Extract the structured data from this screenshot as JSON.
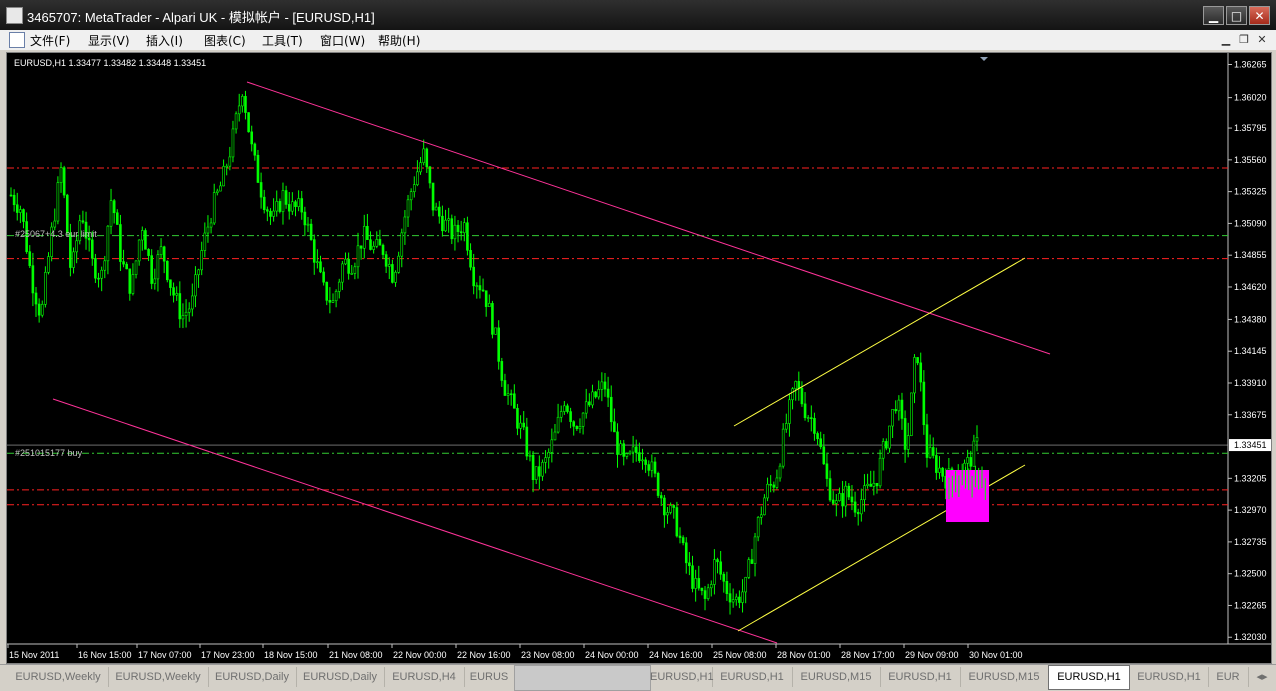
{
  "window": {
    "title": "3465707: MetaTrader - Alpari UK - 模拟帐户 - [EURUSD,H1]",
    "minimize": "▁",
    "maximize": "□",
    "close": "✕"
  },
  "menu": [
    "文件(F)",
    "显示(V)",
    "插入(I)",
    "图表(C)",
    "工具(T)",
    "窗口(W)",
    "帮助(H)"
  ],
  "chart": {
    "header": "EURUSD,H1  1.33477 1.33482 1.33448 1.33451",
    "current_price": "1.33451",
    "order_label_1": "#25067+4.3 eur limit",
    "order_label_2": "#251015177 buy",
    "colors": {
      "background": "#000000",
      "candles": "#00ff00",
      "channel": "#ff3399",
      "triangle": "#ffff44",
      "level_red": "#ff2222",
      "level_green": "#33cc33",
      "box": "#ff00ff"
    }
  },
  "chart_data": {
    "type": "candlestick",
    "symbol": "EURUSD",
    "timeframe": "H1",
    "ohlc_last": {
      "open": 1.33477,
      "high": 1.33482,
      "low": 1.33448,
      "close": 1.33451
    },
    "y_ticks": [
      "1.36265",
      "1.36020",
      "1.35795",
      "1.35560",
      "1.35325",
      "1.35090",
      "1.34855",
      "1.34620",
      "1.34380",
      "1.34145",
      "1.33910",
      "1.33675",
      "1.33451",
      "1.33205",
      "1.32970",
      "1.32735",
      "1.32500",
      "1.32265",
      "1.32030"
    ],
    "x_ticks": [
      "15 Nov 2011",
      "16 Nov 15:00",
      "17 Nov 07:00",
      "17 Nov 23:00",
      "18 Nov 15:00",
      "21 Nov 08:00",
      "22 Nov 00:00",
      "22 Nov 16:00",
      "23 Nov 08:00",
      "24 Nov 00:00",
      "24 Nov 16:00",
      "25 Nov 08:00",
      "28 Nov 01:00",
      "28 Nov 17:00",
      "29 Nov 09:00",
      "30 Nov 01:00"
    ],
    "ylim": [
      1.3198,
      1.3635
    ],
    "close_path": [
      1.353,
      1.352,
      1.347,
      1.344,
      1.35,
      1.355,
      1.347,
      1.352,
      1.348,
      1.347,
      1.353,
      1.348,
      1.346,
      1.351,
      1.347,
      1.349,
      1.346,
      1.344,
      1.345,
      1.349,
      1.352,
      1.354,
      1.357,
      1.361,
      1.356,
      1.353,
      1.351,
      1.353,
      1.352,
      1.352,
      1.349,
      1.346,
      1.345,
      1.348,
      1.348,
      1.35,
      1.349,
      1.349,
      1.347,
      1.351,
      1.354,
      1.356,
      1.352,
      1.351,
      1.35,
      1.351,
      1.347,
      1.346,
      1.343,
      1.339,
      1.337,
      1.335,
      1.332,
      1.333,
      1.335,
      1.338,
      1.336,
      1.337,
      1.338,
      1.339,
      1.335,
      1.333,
      1.334,
      1.334,
      1.332,
      1.33,
      1.329,
      1.326,
      1.324,
      1.323,
      1.326,
      1.324,
      1.323,
      1.324,
      1.328,
      1.331,
      1.332,
      1.336,
      1.339,
      1.337,
      1.336,
      1.332,
      1.33,
      1.331,
      1.33,
      1.331,
      1.332,
      1.335,
      1.338,
      1.334,
      1.342,
      1.334,
      1.333,
      1.332,
      1.3325,
      1.333,
      1.3345
    ],
    "levels_red": [
      1.355,
      1.3483,
      1.3312,
      1.3301
    ],
    "levels_green": [
      1.35,
      1.3339
    ],
    "level_white": 1.33451
  },
  "tabs": [
    "EURUSD,Weekly",
    "EURUSD,Weekly",
    "EURUSD,Daily",
    "EURUSD,Daily",
    "EURUSD,H4",
    "EURUS",
    "",
    "EURUSD,H1",
    "EURUSD,H1",
    "EURUSD,M15",
    "EURUSD,H1",
    "EURUSD,M15",
    "EURUSD,H1",
    "EURUSD,H1",
    "EUR"
  ]
}
